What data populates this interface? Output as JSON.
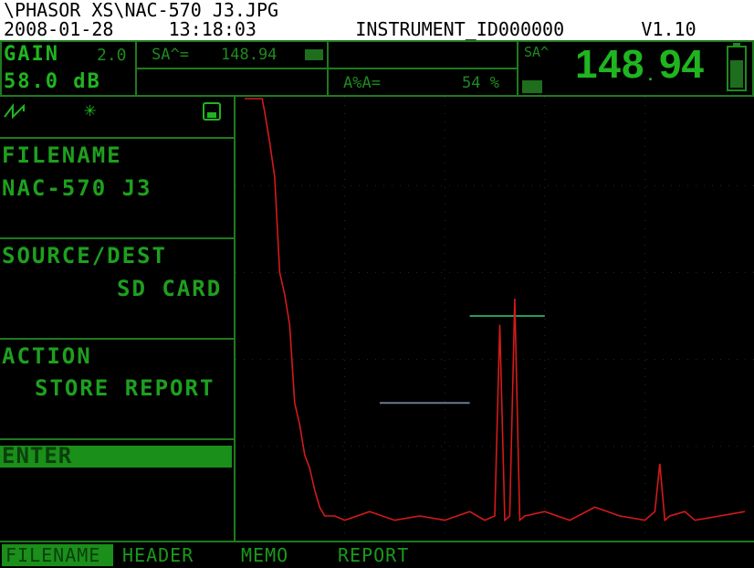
{
  "header": {
    "path": "\\PHASOR XS\\NAC-570 J3.JPG",
    "date": "2008-01-28",
    "time": "13:18:03",
    "instrument_id": "INSTRUMENT_ID000000",
    "version": "V1.10"
  },
  "status": {
    "gain_label": "GAIN",
    "gain_step": "2.0",
    "gain_value": "58.0 dB",
    "sa_label": "SA^=",
    "sa_value": "148.94",
    "a_percent_label": "A%A=",
    "a_percent_value": "54 %",
    "big_label": "SA^",
    "big_value_int": "148",
    "big_value_frac": "94"
  },
  "leftmenu": {
    "filename_label": "FILENAME",
    "filename_value": "NAC-570 J3",
    "source_label": "SOURCE/DEST",
    "source_value": "SD CARD",
    "action_label": "ACTION",
    "action_value": "STORE REPORT",
    "enter_label": "ENTER"
  },
  "tabs": [
    {
      "label": "FILENAME",
      "active": true
    },
    {
      "label": "HEADER",
      "active": false
    },
    {
      "label": "MEMO",
      "active": false
    },
    {
      "label": "REPORT",
      "active": false
    }
  ],
  "icons": [
    "rectify-wave-icon",
    "asterisk-icon",
    "save-disk-icon",
    "battery-icon",
    "freeze-icon"
  ],
  "colors": {
    "screen_green": "#1fb51f",
    "frame_green": "#1f7a1f",
    "signal_red": "#d41a1a",
    "gate_a": "#2a9a5a",
    "gate_b": "#6a7a8a"
  },
  "chart_data": {
    "type": "line",
    "title": "",
    "xlabel": "",
    "ylabel": "",
    "xlim": [
      0,
      100
    ],
    "ylim": [
      0,
      100
    ],
    "grid": true,
    "series": [
      {
        "name": "",
        "x": [
          0,
          3.5,
          4,
          5,
          6,
          7,
          8,
          9,
          10,
          11,
          12,
          13,
          14,
          15,
          16,
          18,
          20,
          25,
          30,
          35,
          40,
          45,
          48,
          50,
          51,
          52,
          53,
          54,
          55,
          56,
          60,
          65,
          70,
          75,
          80,
          82,
          83,
          84,
          85,
          88,
          90,
          95,
          100
        ],
        "y": [
          100,
          100,
          97,
          90,
          82,
          60,
          55,
          48,
          30,
          25,
          18,
          15,
          10,
          6,
          4,
          4,
          3,
          5,
          3,
          4,
          3,
          5,
          3,
          4,
          48,
          3,
          4,
          54,
          3,
          4,
          5,
          3,
          6,
          4,
          3,
          5,
          16,
          3,
          4,
          5,
          3,
          4,
          5
        ]
      }
    ],
    "gates": [
      {
        "name": "",
        "x_start": 27,
        "x_end": 45,
        "level": 30
      },
      {
        "name": "",
        "x_start": 45,
        "x_end": 60,
        "level": 50
      }
    ]
  }
}
